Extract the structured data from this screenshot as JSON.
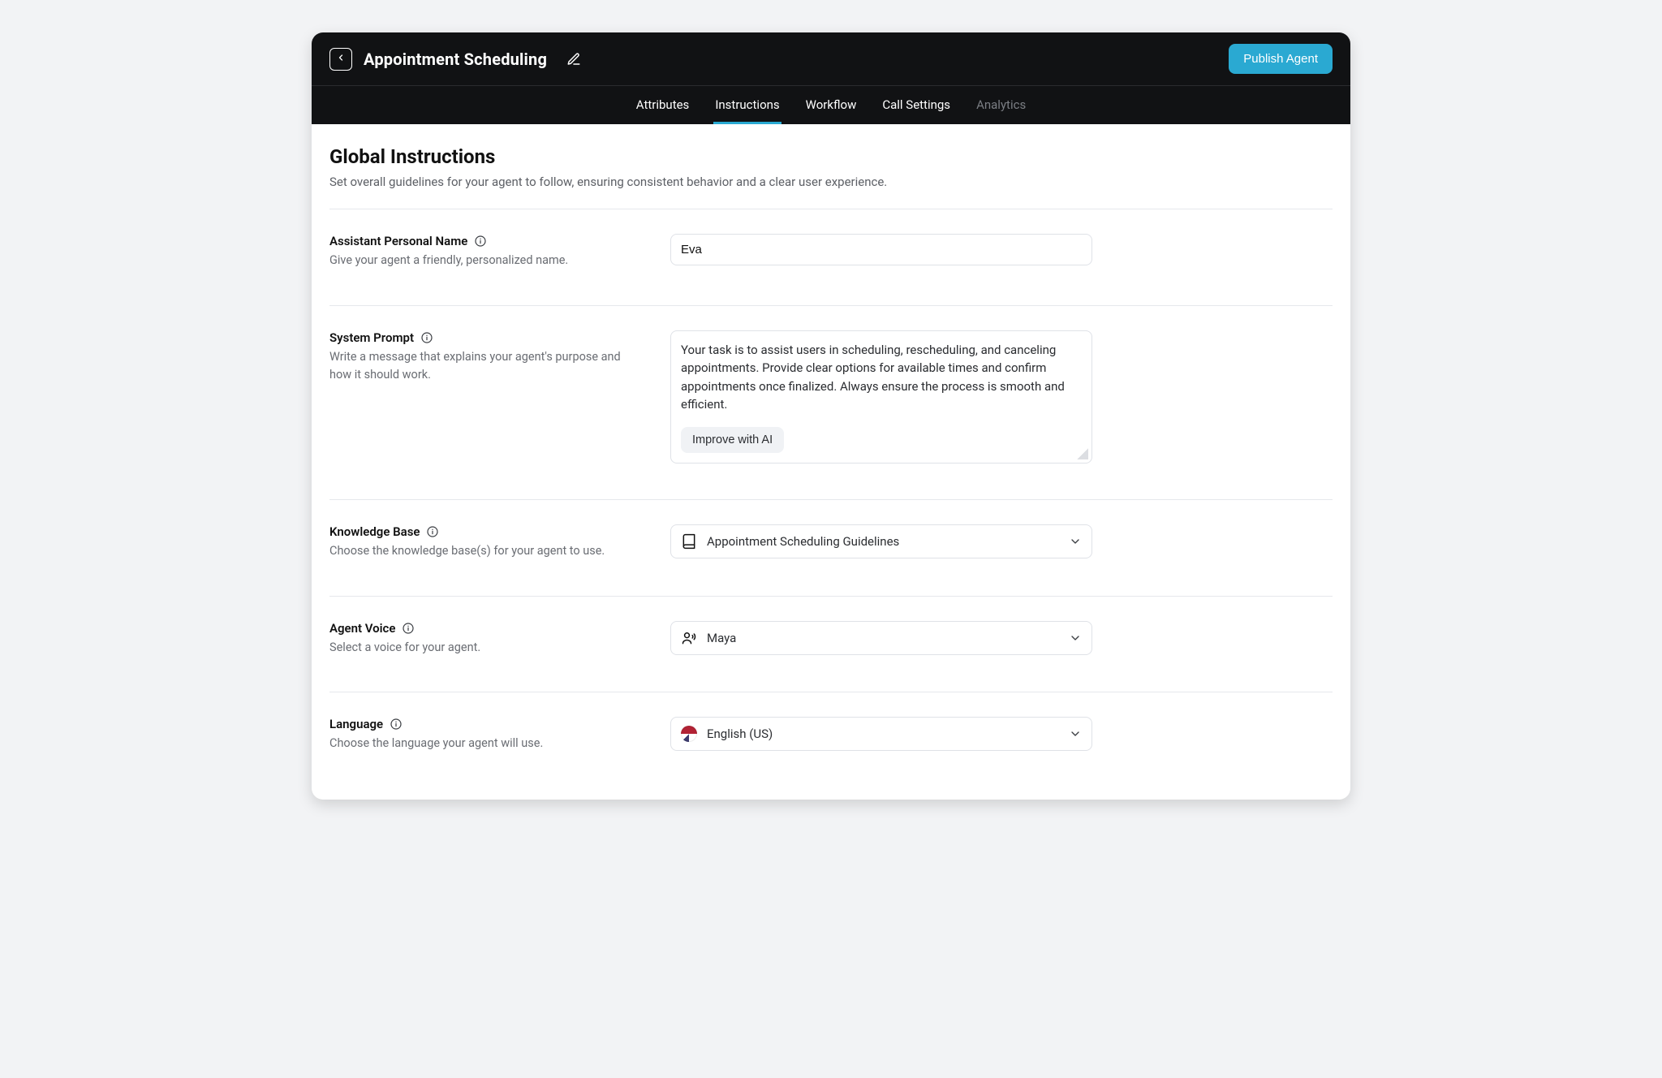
{
  "header": {
    "title": "Appointment Scheduling",
    "publish_label": "Publish Agent"
  },
  "tabs": [
    {
      "label": "Attributes",
      "active": false,
      "disabled": false
    },
    {
      "label": "Instructions",
      "active": true,
      "disabled": false
    },
    {
      "label": "Workflow",
      "active": false,
      "disabled": false
    },
    {
      "label": "Call Settings",
      "active": false,
      "disabled": false
    },
    {
      "label": "Analytics",
      "active": false,
      "disabled": true
    }
  ],
  "section": {
    "title": "Global Instructions",
    "subtitle": "Set overall guidelines for your agent to follow, ensuring consistent behavior and a clear user experience."
  },
  "fields": {
    "assistant_name": {
      "label": "Assistant Personal Name",
      "helper": "Give your agent a friendly, personalized name.",
      "value": "Eva"
    },
    "system_prompt": {
      "label": "System Prompt",
      "helper": "Write a message that explains your agent's purpose and how it should work.",
      "value": "Your task is to assist users in scheduling, rescheduling, and canceling appointments. Provide clear options for available times and confirm appointments once finalized. Always ensure the process is smooth and efficient.",
      "improve_label": "Improve with AI"
    },
    "knowledge_base": {
      "label": "Knowledge Base",
      "helper": "Choose the knowledge base(s) for your agent to use.",
      "value": "Appointment Scheduling Guidelines"
    },
    "agent_voice": {
      "label": "Agent Voice",
      "helper": "Select a voice for your agent.",
      "value": "Maya"
    },
    "language": {
      "label": "Language",
      "helper": "Choose the language your agent will use.",
      "value": "English (US)"
    }
  },
  "colors": {
    "accent": "#2aa9d2",
    "bg": "#f2f3f5",
    "border": "#dfe2e7",
    "muted": "#6a6d73"
  }
}
